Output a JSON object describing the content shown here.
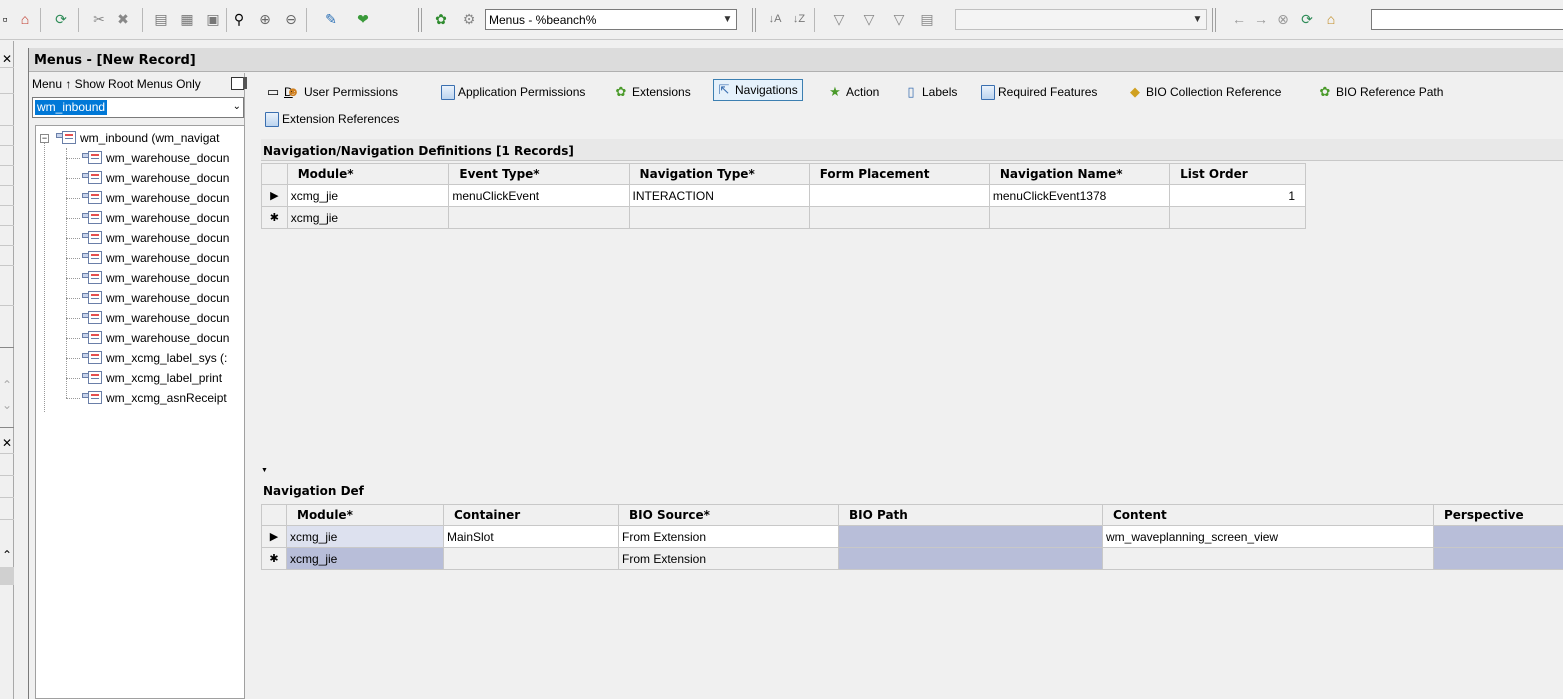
{
  "toolbar": {
    "menu_combo_value": "Menus - %beanch%",
    "filter_combo_value": "",
    "address_input_value": ""
  },
  "window": {
    "title": "Menus -  [New Record]"
  },
  "tree_panel": {
    "filter_label": "Menu ↑  Show Root Menus Only",
    "combo_value": "wm_inbound",
    "root": "wm_inbound  (wm_navigat",
    "children": [
      "wm_warehouse_docun",
      "wm_warehouse_docun",
      "wm_warehouse_docun",
      "wm_warehouse_docun",
      "wm_warehouse_docun",
      "wm_warehouse_docun",
      "wm_warehouse_docun",
      "wm_warehouse_docun",
      "wm_warehouse_docun",
      "wm_warehouse_docun",
      "wm_xcmg_label_sys  (:",
      "wm_xcmg_label_print",
      "wm_xcmg_asnReceipt"
    ]
  },
  "tabs": {
    "id_tab": "D",
    "user_permissions": "User Permissions",
    "application_permissions": "Application Permissions",
    "extensions": "Extensions",
    "navigations": "Navigations",
    "action": "Action",
    "labels": "Labels",
    "required_features": "Required Features",
    "bio_collection_reference": "BIO Collection Reference",
    "bio_reference_path": "BIO Reference Path",
    "extension_references": "Extension References"
  },
  "nav_definitions": {
    "title": "Navigation/Navigation Definitions [1 Records]",
    "columns": [
      "Module*",
      "Event Type*",
      "Navigation Type*",
      "Form Placement",
      "Navigation Name*",
      "List Order"
    ],
    "rows": [
      [
        "xcmg_jie",
        "menuClickEvent",
        "INTERACTION",
        "",
        "menuClickEvent1378",
        "1"
      ]
    ],
    "new_row": [
      "xcmg_jie",
      "",
      "",
      "",
      "",
      ""
    ]
  },
  "nav_def": {
    "title": "Navigation Def",
    "columns": [
      "Module*",
      "Container",
      "BIO Source*",
      "BIO Path",
      "Content",
      "Perspective"
    ],
    "rows": [
      [
        "xcmg_jie",
        "MainSlot",
        "From Extension",
        "",
        "wm_waveplanning_screen_view",
        ""
      ]
    ],
    "new_row": [
      "xcmg_jie",
      "",
      "From Extension",
      "",
      "",
      ""
    ]
  }
}
